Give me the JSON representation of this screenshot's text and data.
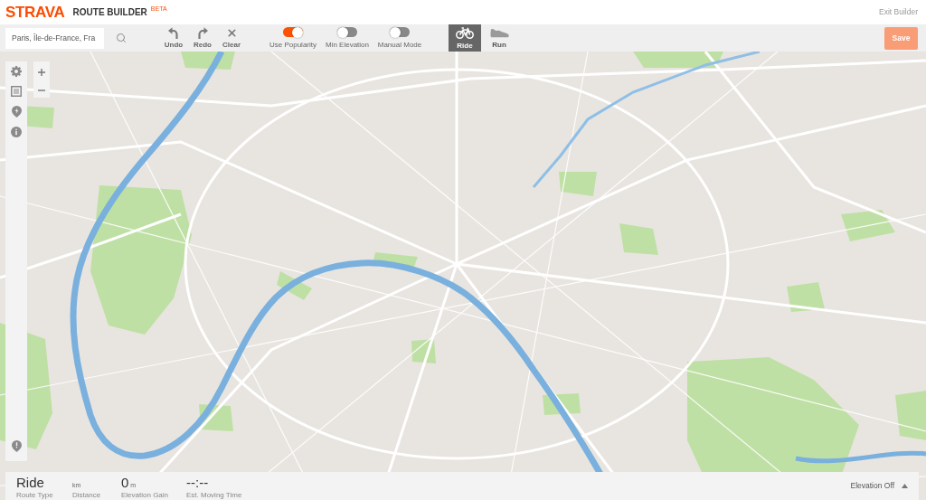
{
  "header": {
    "logo": "STRAVA",
    "title": "ROUTE BUILDER",
    "badge": "BETA",
    "exit_link": "Exit Builder"
  },
  "toolbar": {
    "search": {
      "value": "Paris, Île-de-France, Fra"
    },
    "actions": [
      {
        "kind": "undo",
        "label": "Undo"
      },
      {
        "kind": "redo",
        "label": "Redo"
      },
      {
        "kind": "clear",
        "label": "Clear"
      }
    ],
    "toggles": [
      {
        "label": "Use Popularity",
        "on": true
      },
      {
        "label": "Min Elevation",
        "on": false
      },
      {
        "label": "Manual Mode",
        "on": false
      }
    ],
    "route_types": [
      {
        "kind": "ride",
        "label": "Ride",
        "selected": true
      },
      {
        "kind": "run",
        "label": "Run",
        "selected": false
      }
    ],
    "save_button": {
      "label": "Save",
      "disabled": true
    }
  },
  "stats": [
    {
      "value": "Ride",
      "label": "Route Type"
    },
    {
      "unit": "km",
      "label": "Distance"
    },
    {
      "value": "0",
      "unit": "m",
      "label": "Elevation Gain"
    },
    {
      "value": "--:--",
      "label": "Est. Moving Time"
    }
  ],
  "elevation_panel": {
    "label": "Elevation Off",
    "expanded": false
  }
}
